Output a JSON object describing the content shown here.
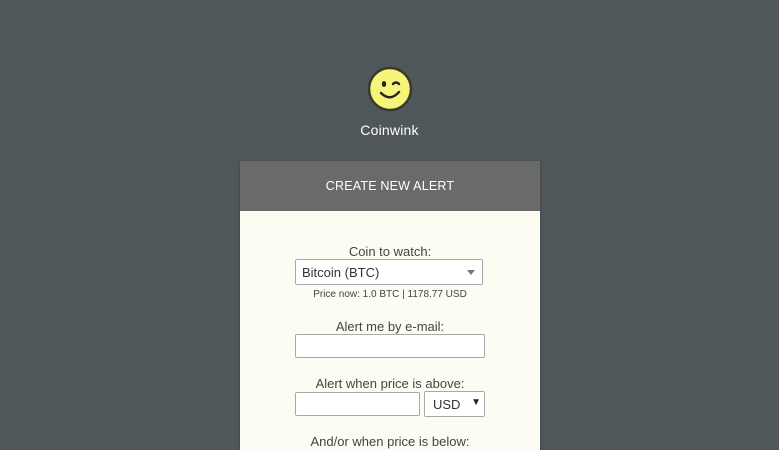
{
  "app": {
    "brand": "Coinwink"
  },
  "card": {
    "header": "CREATE NEW ALERT",
    "coin_label": "Coin to watch:",
    "coin_selected": "Bitcoin (BTC)",
    "price_hint": "Price now: 1.0 BTC | 1178.77 USD",
    "email_label": "Alert me by e-mail:",
    "email_value": "",
    "above_label": "Alert when price is above:",
    "above_value": "",
    "above_currency": "USD",
    "below_label": "And/or when price is below:"
  },
  "colors": {
    "background": "#50575a",
    "header": "#6a6a6a",
    "card": "#fcfcf2",
    "logo_fill": "#f6f57a"
  },
  "icons": {
    "logo": "smiley-wink-icon",
    "coin_dropdown": "chevron-down-icon",
    "currency_dropdown": "triangle-down-icon"
  }
}
